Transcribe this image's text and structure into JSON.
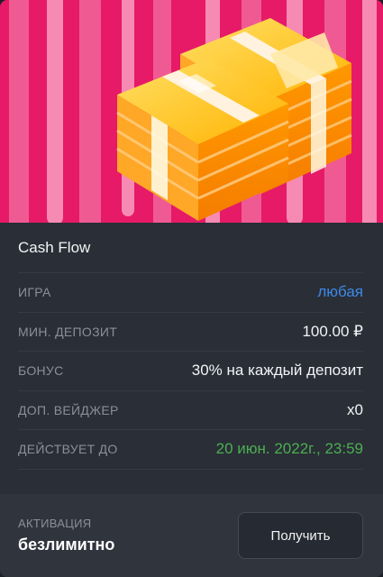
{
  "colors": {
    "accent_link": "#3d8ae6",
    "accent_green": "#4caf50",
    "hero_bg": "#e61a67"
  },
  "hero": {
    "image": "money-stack-illustration"
  },
  "bonus": {
    "title": "Cash Flow",
    "rows": [
      {
        "label": "ИГРА",
        "value": "любая"
      },
      {
        "label": "МИН. ДЕПОЗИТ",
        "value": "100.00 ₽"
      },
      {
        "label": "БОНУС",
        "value": "30% на каждый депозит"
      },
      {
        "label": "ДОП. ВЕЙДЖЕР",
        "value": "x0"
      },
      {
        "label": "ДЕЙСТВУЕТ ДО",
        "value": "20 июн. 2022г., 23:59"
      }
    ]
  },
  "activation": {
    "label": "АКТИВАЦИЯ",
    "value": "безлимитно"
  },
  "claim_button": {
    "label": "Получить"
  }
}
